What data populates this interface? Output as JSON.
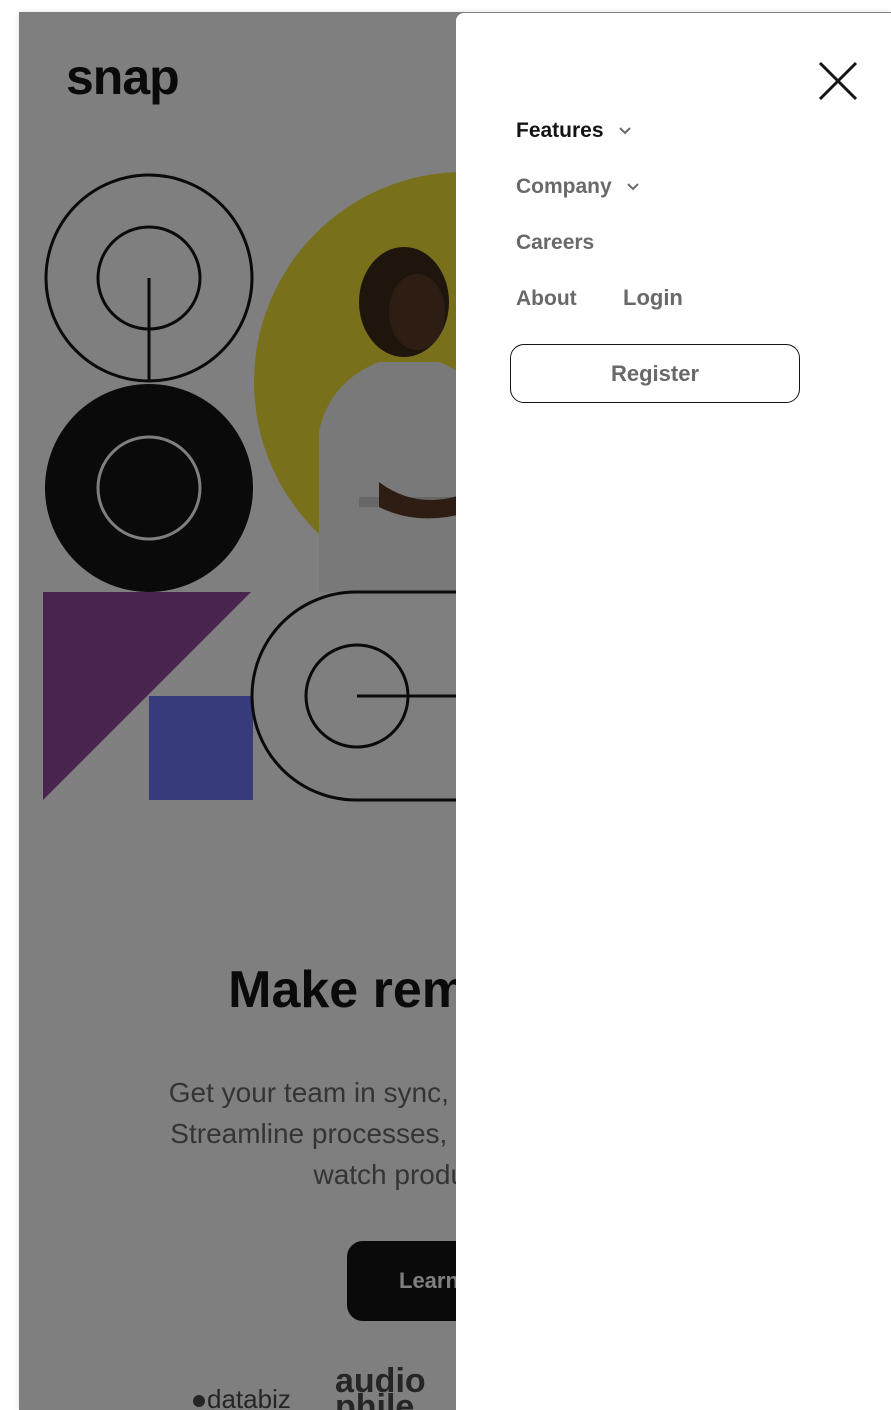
{
  "app": {
    "logo_text": "snap"
  },
  "hero": {
    "headline": "Make remote work",
    "subtext_lines": [
      "Get your team in sync, no matter your location.",
      "Streamline processes, create team rituals, and",
      "watch productivity soar."
    ],
    "cta_label": "Learn more"
  },
  "clients": {
    "databiz": "databiz",
    "audiophile": "audio phile"
  },
  "drawer": {
    "close_icon": "close-icon",
    "nav": [
      {
        "label": "Features",
        "has_dropdown": true,
        "active": true
      },
      {
        "label": "Company",
        "has_dropdown": true,
        "active": false
      },
      {
        "label": "Careers",
        "has_dropdown": false,
        "active": false
      },
      {
        "label": "About",
        "has_dropdown": false,
        "active": false
      }
    ],
    "login_label": "Login",
    "register_label": "Register"
  },
  "colors": {
    "accent_dark": "#141414",
    "text_muted": "#696969",
    "overlay": "#00000080",
    "yellow_circle": "#f1e037",
    "purple_triangle": "#91489d",
    "blue_square": "#6f77f6"
  }
}
